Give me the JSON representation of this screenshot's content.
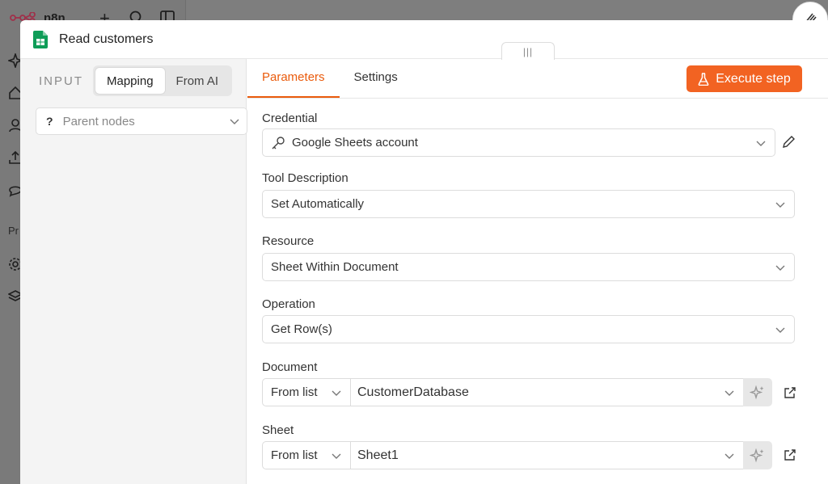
{
  "app": {
    "brand": "n8n"
  },
  "bg_sidebar": {
    "section_fragment": "Pr"
  },
  "modal": {
    "title": "Read customers",
    "drag_handle": "|||"
  },
  "input_panel": {
    "label": "INPUT",
    "modes": [
      "Mapping",
      "From AI"
    ],
    "active_mode": "Mapping",
    "parent_nodes_placeholder": "Parent nodes",
    "parent_nodes_icon": "?"
  },
  "tabs": [
    {
      "label": "Parameters",
      "active": true
    },
    {
      "label": "Settings",
      "active": false
    }
  ],
  "execute_button": {
    "label": "Execute step",
    "icon": "flask-icon"
  },
  "fields": {
    "credential": {
      "label": "Credential",
      "value": "Google Sheets account"
    },
    "tool_description": {
      "label": "Tool Description",
      "value": "Set Automatically"
    },
    "resource": {
      "label": "Resource",
      "value": "Sheet Within Document"
    },
    "operation": {
      "label": "Operation",
      "value": "Get Row(s)"
    },
    "document": {
      "label": "Document",
      "mode": "From list",
      "value": "CustomerDatabase"
    },
    "sheet": {
      "label": "Sheet",
      "mode": "From list",
      "value": "Sheet1"
    }
  },
  "colors": {
    "accent": "#ea5b0c",
    "button": "#f26322",
    "sheets_green": "#0f9d58"
  }
}
